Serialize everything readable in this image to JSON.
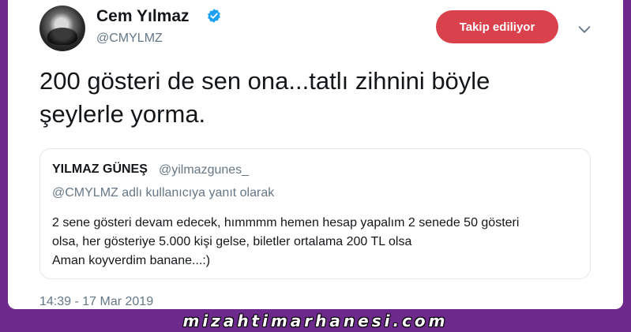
{
  "tweet": {
    "author_name": "Cem Yılmaz",
    "author_handle": "@CMYLMZ",
    "follow_label": "Takip ediliyor",
    "text_line1": "200 gösteri de sen ona...tatlı zihnini böyle",
    "text_line2": "şeylerle yorma.",
    "timestamp": "14:39 - 17 Mar 2019"
  },
  "quoted": {
    "author_name": "YILMAZ GÜNEŞ",
    "author_handle": "@yilmazgunes_",
    "reply_context": "@CMYLMZ adlı kullanıcıya yanıt olarak",
    "body_lines": [
      "2 sene gösteri devam edecek, hımmmm hemen hesap yapalım 2 senede 50 gösteri",
      "olsa, her gösteriye 5.000 kişi gelse, biletler ortalama 200 TL olsa",
      "Aman koyverdim banane...:)"
    ]
  },
  "watermark": "mizahtimarhanesi.com",
  "colors": {
    "background": "#6d2a8c",
    "follow_button": "#d9414c",
    "verified_badge": "#1da1f2",
    "secondary_text": "#657786"
  },
  "icons": {
    "verified": "verified-badge-icon",
    "menu": "chevron-down-icon"
  }
}
